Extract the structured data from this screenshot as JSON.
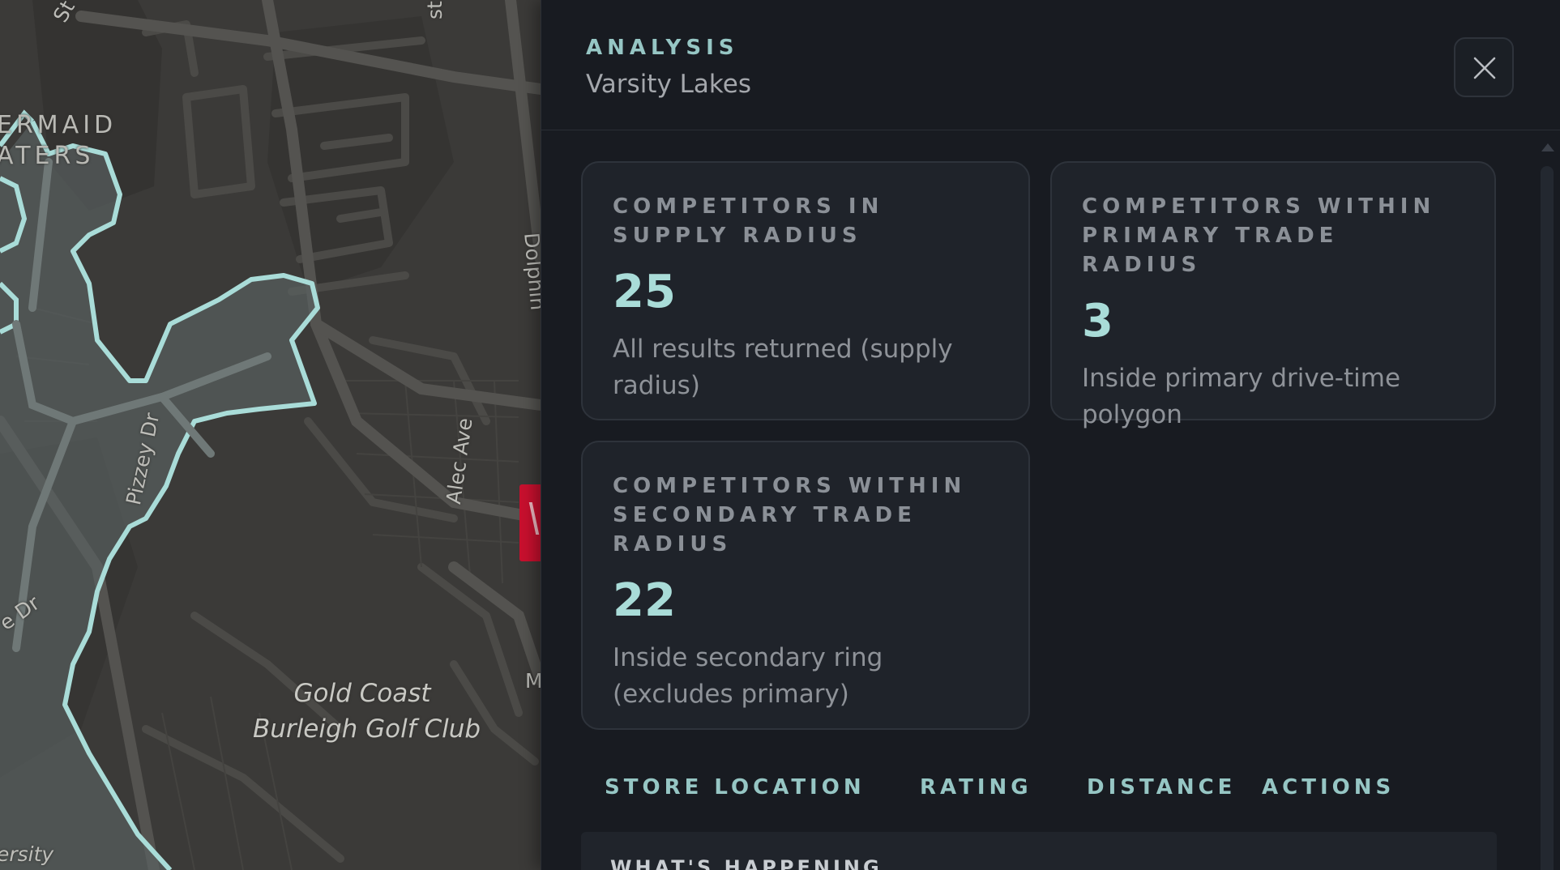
{
  "map": {
    "labels": {
      "suburb": "ERMAID\nATERS",
      "road_pizzey": "Pizzey Dr",
      "road_alec": "Alec Ave",
      "road_dolphin": "Dolphin",
      "road_e_dr": "e Dr",
      "road_st": "St",
      "road_st_top": "st",
      "road_m": "M",
      "golf_club": "Gold Coast\nBurleigh Golf Club",
      "varsity": "ersity"
    },
    "colors": {
      "base": "#3b3a38",
      "boundary": "#a9dcd8",
      "marker": "#c8102e"
    }
  },
  "panel": {
    "eyebrow": "ANALYSIS",
    "subtitle": "Varsity Lakes",
    "close_icon": "close-icon",
    "cards": [
      {
        "label": "Competitors in supply radius",
        "value": "25",
        "desc": "All results returned (supply radius)"
      },
      {
        "label": "Competitors within primary trade radius",
        "value": "3",
        "desc": "Inside primary drive-time polygon"
      },
      {
        "label": "Competitors within secondary trade radius",
        "value": "22",
        "desc": "Inside secondary ring (excludes primary)"
      }
    ],
    "table": {
      "columns": [
        "Store location",
        "Rating",
        "Distance",
        "Actions"
      ],
      "first_row_partial": "WHAT'S HAPPENING"
    },
    "colors": {
      "accent": "#96c6c4",
      "value": "#a9dcd8",
      "card_bg": "#1f232a"
    }
  }
}
